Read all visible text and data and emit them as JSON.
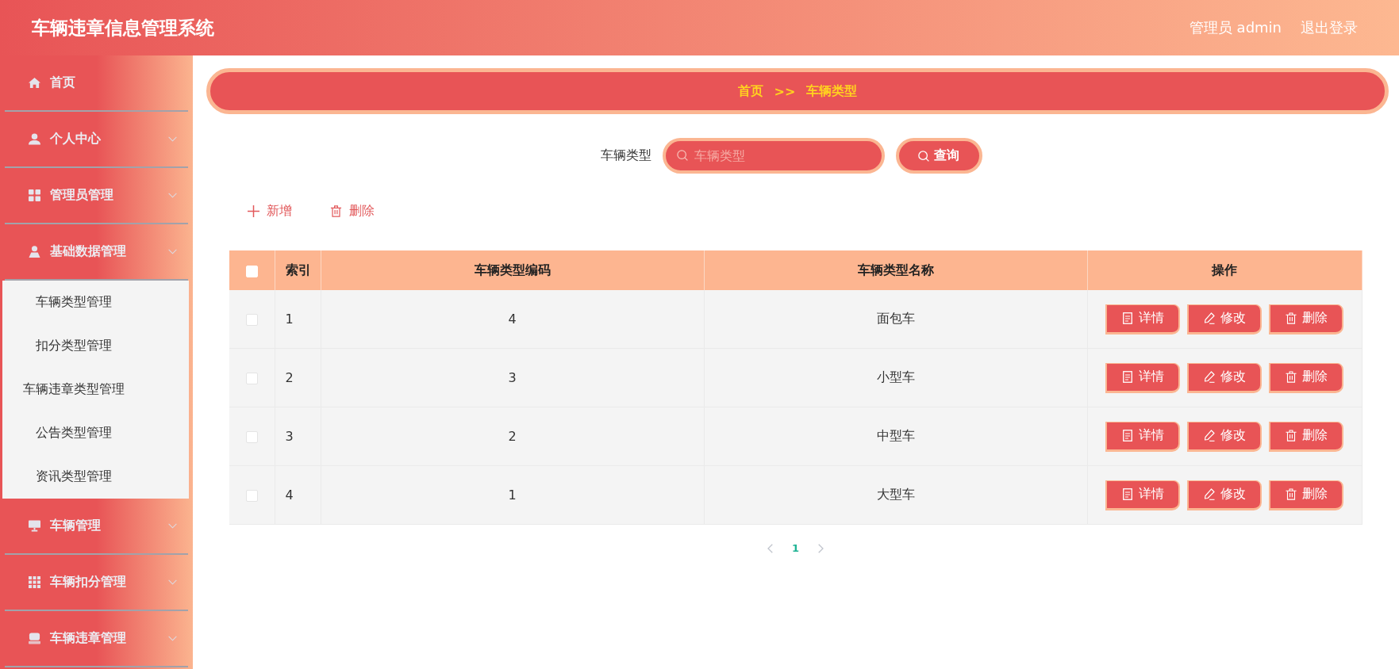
{
  "header": {
    "title": "车辆违章信息管理系统",
    "user": "管理员 admin",
    "logout": "退出登录"
  },
  "sidebar": {
    "items": [
      {
        "kind": "link",
        "label": "首页"
      },
      {
        "kind": "submenu",
        "label": "个人中心"
      },
      {
        "kind": "submenu",
        "label": "管理员管理"
      },
      {
        "kind": "submenu",
        "label": "基础数据管理",
        "expanded": true,
        "children": [
          {
            "label": "车辆类型管理"
          },
          {
            "label": "扣分类型管理"
          },
          {
            "label": "车辆违章类型管理"
          },
          {
            "label": "公告类型管理"
          },
          {
            "label": "资讯类型管理"
          }
        ]
      },
      {
        "kind": "submenu",
        "label": "车辆管理"
      },
      {
        "kind": "submenu",
        "label": "车辆扣分管理"
      },
      {
        "kind": "submenu",
        "label": "车辆违章管理"
      }
    ]
  },
  "breadcrumb": {
    "items": [
      "首页",
      "车辆类型"
    ],
    "separator": ">>"
  },
  "search": {
    "label": "车辆类型",
    "placeholder": "车辆类型",
    "button": "查询"
  },
  "toolbar": [
    {
      "kind": "add",
      "label": "新增"
    },
    {
      "kind": "delete",
      "label": "删除"
    }
  ],
  "table": {
    "select_all": {
      "checked": false
    },
    "columns": [
      "索引",
      "车辆类型编码",
      "车辆类型名称",
      "操作"
    ],
    "rows": [
      {
        "checked": false,
        "cells": [
          "1",
          "4",
          "面包车"
        ],
        "actions": [
          {
            "kind": "detail",
            "label": "详情"
          },
          {
            "kind": "edit",
            "label": "修改"
          },
          {
            "kind": "delete",
            "label": "删除"
          }
        ]
      },
      {
        "checked": false,
        "cells": [
          "2",
          "3",
          "小型车"
        ],
        "actions": [
          {
            "kind": "detail",
            "label": "详情"
          },
          {
            "kind": "edit",
            "label": "修改"
          },
          {
            "kind": "delete",
            "label": "删除"
          }
        ]
      },
      {
        "checked": false,
        "cells": [
          "3",
          "2",
          "中型车"
        ],
        "actions": [
          {
            "kind": "detail",
            "label": "详情"
          },
          {
            "kind": "edit",
            "label": "修改"
          },
          {
            "kind": "delete",
            "label": "删除"
          }
        ]
      },
      {
        "checked": false,
        "cells": [
          "4",
          "1",
          "大型车"
        ],
        "actions": [
          {
            "kind": "detail",
            "label": "详情"
          },
          {
            "kind": "edit",
            "label": "修改"
          },
          {
            "kind": "delete",
            "label": "删除"
          }
        ]
      }
    ]
  },
  "pagination": {
    "prev": {
      "disabled": true
    },
    "pages": [
      {
        "label": "1",
        "selected": true
      }
    ],
    "next": {
      "disabled": true
    }
  }
}
